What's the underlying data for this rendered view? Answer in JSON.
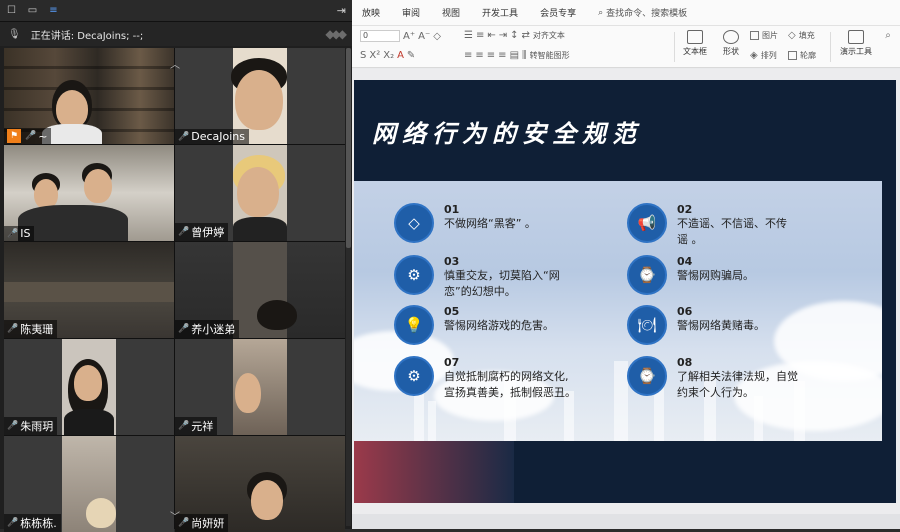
{
  "meeting": {
    "speaking_label": "正在讲话: DecaJoins; --;",
    "participants": [
      {
        "name": "~",
        "host": true
      },
      {
        "name": "DecaJoins",
        "active": true
      },
      {
        "name": "IS"
      },
      {
        "name": "曾伊婷"
      },
      {
        "name": "陈夷珊"
      },
      {
        "name": "养小迷弟"
      },
      {
        "name": "朱雨玥"
      },
      {
        "name": "元祥"
      },
      {
        "name": "栋栋栋."
      },
      {
        "name": "尚妍妍"
      }
    ]
  },
  "app": {
    "menu": [
      "放映",
      "审阅",
      "视图",
      "开发工具",
      "会员专享"
    ],
    "search_placeholder": "查找命令、搜索模板",
    "ribbon": {
      "font_size": "0",
      "align_text": "对齐文本",
      "convert_smartart": "转智能图形",
      "textbox": "文本框",
      "shape": "形状",
      "picture": "图片",
      "arrange": "排列",
      "fill": "填充",
      "outline": "轮廓",
      "presenter_tools": "演示工具"
    }
  },
  "slide": {
    "title": "网络行为的安全规范",
    "items": [
      {
        "num": "01",
        "text": "不做网络“黑客” 。",
        "icon": "diamond-icon"
      },
      {
        "num": "02",
        "text": "不造谣、不信谣、不传谣 。",
        "icon": "megaphone-icon"
      },
      {
        "num": "03",
        "text": "慎重交友，切莫陷入“网恋”的幻想中。",
        "icon": "gear-icon"
      },
      {
        "num": "04",
        "text": "警惕网购骗局。",
        "icon": "watch-icon"
      },
      {
        "num": "05",
        "text": "警惕网络游戏的危害。",
        "icon": "bulb-icon"
      },
      {
        "num": "06",
        "text": "警惕网络黄赌毒。",
        "icon": "dish-icon"
      },
      {
        "num": "07",
        "text": "自觉抵制腐朽的网络文化,宣扬真善美，抵制假恶丑。",
        "icon": "gear-icon"
      },
      {
        "num": "08",
        "text": "了解相关法律法规，自觉约束个人行为。",
        "icon": "watch-icon"
      }
    ]
  }
}
